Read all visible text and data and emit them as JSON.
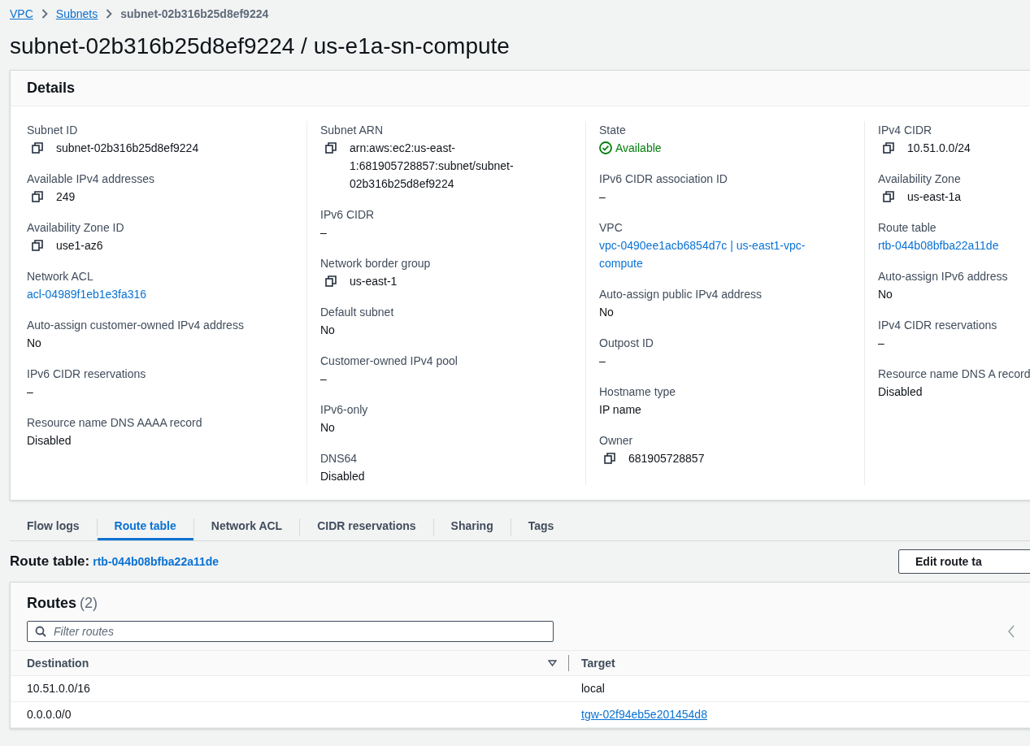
{
  "breadcrumbs": [
    {
      "label": "VPC",
      "kind": "link"
    },
    {
      "label": "Subnets",
      "kind": "link"
    },
    {
      "label": "subnet-02b316b25d8ef9224",
      "kind": "current"
    }
  ],
  "title": "subnet-02b316b25d8ef9224 / us-e1a-sn-compute",
  "details": {
    "heading": "Details",
    "columns": [
      [
        {
          "label": "Subnet ID",
          "value": "subnet-02b316b25d8ef9224",
          "kind": "copy"
        },
        {
          "label": "Available IPv4 addresses",
          "value": "249",
          "kind": "copy"
        },
        {
          "label": "Availability Zone ID",
          "value": "use1-az6",
          "kind": "copy"
        },
        {
          "label": "Network ACL",
          "value": "acl-04989f1eb1e3fa316",
          "kind": "link"
        },
        {
          "label": "Auto-assign customer-owned IPv4 address",
          "value": "No",
          "kind": "text"
        },
        {
          "label": "IPv6 CIDR reservations",
          "value": "–",
          "kind": "text"
        },
        {
          "label": "Resource name DNS AAAA record",
          "value": "Disabled",
          "kind": "text"
        }
      ],
      [
        {
          "label": "Subnet ARN",
          "value": "arn:aws:ec2:us-east-1:681905728857:subnet/subnet-02b316b25d8ef9224",
          "kind": "copy"
        },
        {
          "label": "IPv6 CIDR",
          "value": "–",
          "kind": "text"
        },
        {
          "label": "Network border group",
          "value": "us-east-1",
          "kind": "copy"
        },
        {
          "label": "Default subnet",
          "value": "No",
          "kind": "text"
        },
        {
          "label": "Customer-owned IPv4 pool",
          "value": "–",
          "kind": "text"
        },
        {
          "label": "IPv6-only",
          "value": "No",
          "kind": "text"
        },
        {
          "label": "DNS64",
          "value": "Disabled",
          "kind": "text"
        }
      ],
      [
        {
          "label": "State",
          "value": "Available",
          "kind": "status"
        },
        {
          "label": "IPv6 CIDR association ID",
          "value": "–",
          "kind": "text"
        },
        {
          "label": "VPC",
          "value": "vpc-0490ee1acb6854d7c | us-east1-vpc-compute",
          "kind": "link"
        },
        {
          "label": "Auto-assign public IPv4 address",
          "value": "No",
          "kind": "text"
        },
        {
          "label": "Outpost ID",
          "value": "–",
          "kind": "text"
        },
        {
          "label": "Hostname type",
          "value": "IP name",
          "kind": "text"
        },
        {
          "label": "Owner",
          "value": "681905728857",
          "kind": "copy"
        }
      ],
      [
        {
          "label": "IPv4 CIDR",
          "value": "10.51.0.0/24",
          "kind": "copy"
        },
        {
          "label": "Availability Zone",
          "value": "us-east-1a",
          "kind": "copy"
        },
        {
          "label": "Route table",
          "value": "rtb-044b08bfba22a11de",
          "kind": "link"
        },
        {
          "label": "Auto-assign IPv6 address",
          "value": "No",
          "kind": "text"
        },
        {
          "label": "IPv4 CIDR reservations",
          "value": "–",
          "kind": "text"
        },
        {
          "label": "Resource name DNS A record",
          "value": "Disabled",
          "kind": "text"
        }
      ]
    ]
  },
  "tabs": [
    {
      "label": "Flow logs",
      "selected": false
    },
    {
      "label": "Route table",
      "selected": true
    },
    {
      "label": "Network ACL",
      "selected": false
    },
    {
      "label": "CIDR reservations",
      "selected": false
    },
    {
      "label": "Sharing",
      "selected": false
    },
    {
      "label": "Tags",
      "selected": false
    }
  ],
  "route_table": {
    "label": "Route table:",
    "id": "rtb-044b08bfba22a11de",
    "edit_button": "Edit route ta"
  },
  "routes": {
    "heading": "Routes",
    "count": "(2)",
    "filter": {
      "placeholder": "Filter routes"
    },
    "columns": [
      "Destination",
      "Target"
    ],
    "rows": [
      {
        "destination": "10.51.0.0/16",
        "target": "local",
        "kind": "text"
      },
      {
        "destination": "0.0.0.0/0",
        "target": "tgw-02f94eb5e201454d8",
        "kind": "link"
      }
    ]
  }
}
